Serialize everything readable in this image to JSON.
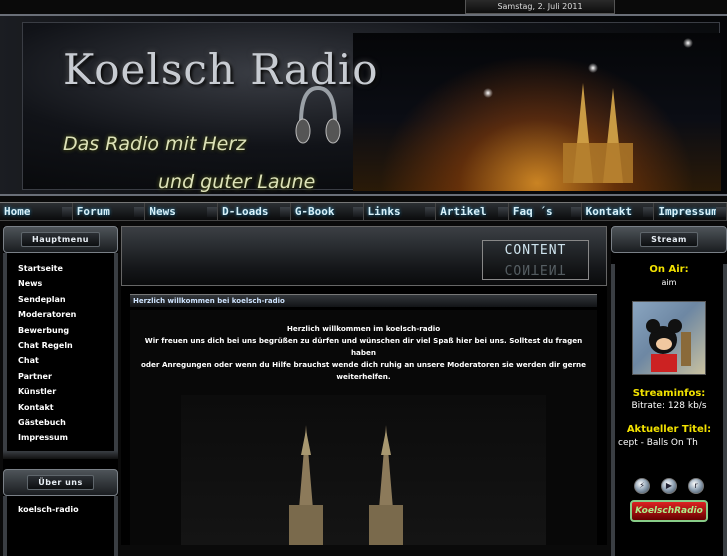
{
  "date": "Samstag, 2. Juli 2011",
  "header": {
    "logo": "Koelsch Radio",
    "slogan_line1": "Das Radio mit Herz",
    "slogan_line2": "und guter Laune"
  },
  "nav": [
    "Home",
    "Forum",
    "News",
    "D-Loads",
    "G-Book",
    "Links",
    "Artikel",
    "Faq ´s",
    "Kontakt",
    "Impressum"
  ],
  "hauptmenu": {
    "title": "Hauptmenu",
    "items": [
      "Startseite",
      "News",
      "Sendeplan",
      "Moderatoren",
      "Bewerbung",
      "Chat Regeln",
      "Chat",
      "Partner",
      "Künstler",
      "Kontakt",
      "Gästebuch",
      "Impressum"
    ]
  },
  "uber_uns": {
    "title": "Über uns",
    "item": "koelsch-radio"
  },
  "content": {
    "tag": "CONTENT",
    "welcome_title": "Herzlich willkommen bei koelsch-radio",
    "welcome_heading": "Herzlich willkommen im koelsch-radio",
    "welcome_line1": "Wir freuen uns dich bei uns begrüßen zu dürfen und wünschen dir viel Spaß hier bei uns. Solltest du fragen haben",
    "welcome_line2": "oder Anregungen oder wenn du Hilfe brauchst wende dich ruhig an unsere Moderatoren sie werden dir gerne",
    "welcome_line3": "weiterhelfen."
  },
  "stream": {
    "title": "Stream",
    "onair_label": "On Air:",
    "onair_value": "aim",
    "streaminfo_label": "Streaminfos:",
    "bitrate": "Bitrate: 128 kb/s",
    "title_label": "Aktueller Titel:",
    "title_value": "cept - Balls On Th",
    "charts": "KoelschRadio"
  },
  "colors": {
    "accent_yellow": "#f2e200",
    "nav_text": "#d8f0f8"
  }
}
